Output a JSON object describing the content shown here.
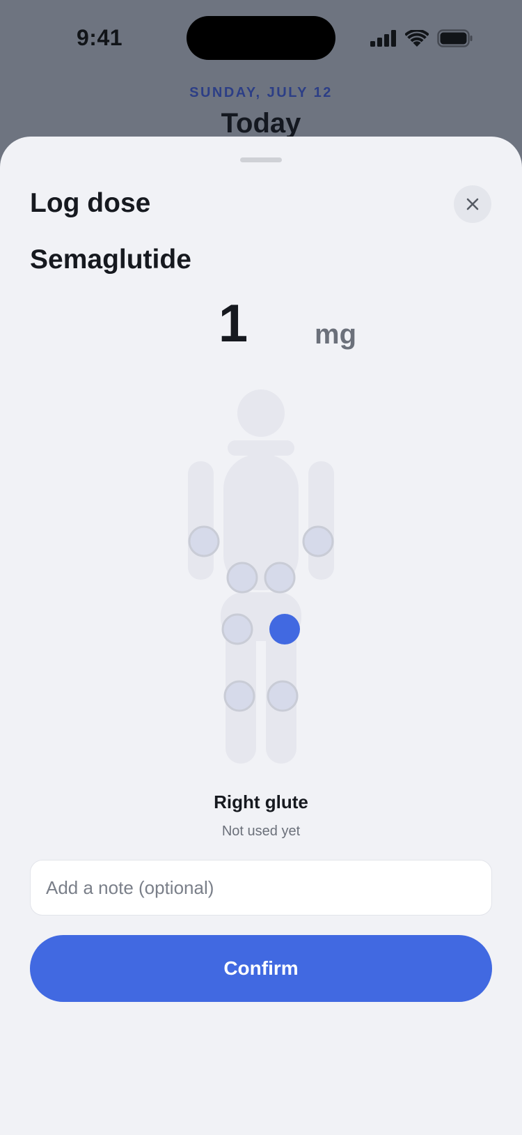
{
  "status_bar": {
    "time": "9:41",
    "icons": [
      "cellular-signal-icon",
      "wifi-icon",
      "battery-icon"
    ]
  },
  "background_page": {
    "date": "SUNDAY, JULY 12",
    "title": "Today"
  },
  "sheet": {
    "title": "Log dose",
    "close_icon": "close-icon",
    "medication": "Semaglutide",
    "dose": {
      "value": "1",
      "unit": "mg"
    },
    "injection_sites": [
      {
        "id": "left-arm",
        "selected": false
      },
      {
        "id": "right-arm",
        "selected": false
      },
      {
        "id": "left-abdomen",
        "selected": false
      },
      {
        "id": "right-abdomen",
        "selected": false
      },
      {
        "id": "left-glute",
        "selected": false
      },
      {
        "id": "right-glute",
        "selected": true
      },
      {
        "id": "left-thigh",
        "selected": false
      },
      {
        "id": "right-thigh",
        "selected": false
      }
    ],
    "selected_site": {
      "name": "Right glute",
      "status": "Not used yet"
    },
    "note": {
      "value": "",
      "placeholder": "Add a note (optional)"
    },
    "confirm_label": "Confirm"
  },
  "colors": {
    "accent": "#4169e1",
    "sheet_background": "#f1f2f6",
    "dimmed_background": "#6e7480",
    "body_silhouette": "#e6e7ee",
    "site_unselected": "#d6daea"
  }
}
